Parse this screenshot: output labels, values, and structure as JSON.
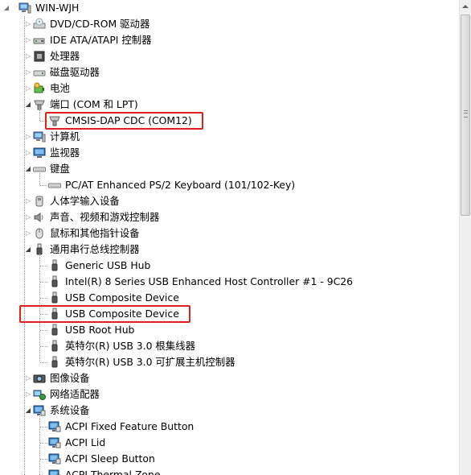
{
  "tree": {
    "root": {
      "label": "WIN-WJH",
      "icon": "computer-icon"
    },
    "items": [
      {
        "label": "DVD/CD-ROM 驱动器",
        "level": 1,
        "state": "collapsed",
        "icon": "dvd-drive-icon"
      },
      {
        "label": "IDE ATA/ATAPI 控制器",
        "level": 1,
        "state": "collapsed",
        "icon": "ide-controller-icon"
      },
      {
        "label": "处理器",
        "level": 1,
        "state": "collapsed",
        "icon": "processor-icon"
      },
      {
        "label": "磁盘驱动器",
        "level": 1,
        "state": "collapsed",
        "icon": "disk-drive-icon"
      },
      {
        "label": "电池",
        "level": 1,
        "state": "collapsed",
        "icon": "battery-icon"
      },
      {
        "label": "端口 (COM 和 LPT)",
        "level": 1,
        "state": "expanded",
        "icon": "port-icon"
      },
      {
        "label": "CMSIS-DAP CDC (COM12)",
        "level": 2,
        "state": "leaf",
        "icon": "port-icon",
        "highlighted": true
      },
      {
        "label": "计算机",
        "level": 1,
        "state": "collapsed",
        "icon": "computer-icon"
      },
      {
        "label": "监视器",
        "level": 1,
        "state": "collapsed",
        "icon": "monitor-icon"
      },
      {
        "label": "键盘",
        "level": 1,
        "state": "expanded",
        "icon": "keyboard-icon"
      },
      {
        "label": "PC/AT Enhanced PS/2 Keyboard (101/102-Key)",
        "level": 2,
        "state": "leaf",
        "icon": "keyboard-icon"
      },
      {
        "label": "人体学输入设备",
        "level": 1,
        "state": "collapsed",
        "icon": "hid-icon"
      },
      {
        "label": "声音、视频和游戏控制器",
        "level": 1,
        "state": "collapsed",
        "icon": "speaker-icon"
      },
      {
        "label": "鼠标和其他指针设备",
        "level": 1,
        "state": "collapsed",
        "icon": "mouse-icon"
      },
      {
        "label": "通用串行总线控制器",
        "level": 1,
        "state": "expanded",
        "icon": "usb-icon"
      },
      {
        "label": "Generic USB Hub",
        "level": 2,
        "state": "leaf",
        "icon": "usb-icon"
      },
      {
        "label": "Intel(R) 8 Series USB Enhanced Host Controller #1 - 9C26",
        "level": 2,
        "state": "leaf",
        "icon": "usb-icon"
      },
      {
        "label": "USB Composite Device",
        "level": 2,
        "state": "leaf",
        "icon": "usb-icon"
      },
      {
        "label": "USB Composite Device",
        "level": 2,
        "state": "leaf",
        "icon": "usb-icon",
        "highlighted": true
      },
      {
        "label": "USB Root Hub",
        "level": 2,
        "state": "leaf",
        "icon": "usb-icon"
      },
      {
        "label": "英特尔(R) USB 3.0 根集线器",
        "level": 2,
        "state": "leaf",
        "icon": "usb-icon"
      },
      {
        "label": "英特尔(R) USB 3.0 可扩展主机控制器",
        "level": 2,
        "state": "leaf",
        "icon": "usb-icon"
      },
      {
        "label": "图像设备",
        "level": 1,
        "state": "collapsed",
        "icon": "camera-icon"
      },
      {
        "label": "网络适配器",
        "level": 1,
        "state": "collapsed",
        "icon": "network-adapter-icon"
      },
      {
        "label": "系统设备",
        "level": 1,
        "state": "expanded",
        "icon": "system-device-icon"
      },
      {
        "label": "ACPI Fixed Feature Button",
        "level": 2,
        "state": "leaf",
        "icon": "system-device-icon"
      },
      {
        "label": "ACPI Lid",
        "level": 2,
        "state": "leaf",
        "icon": "system-device-icon"
      },
      {
        "label": "ACPI Sleep Button",
        "level": 2,
        "state": "leaf",
        "icon": "system-device-icon"
      },
      {
        "label": "ACPI Thermal Zone",
        "level": 2,
        "state": "leaf",
        "icon": "system-device-icon"
      }
    ]
  },
  "colors": {
    "highlight": "#e02020",
    "text": "#000000"
  }
}
